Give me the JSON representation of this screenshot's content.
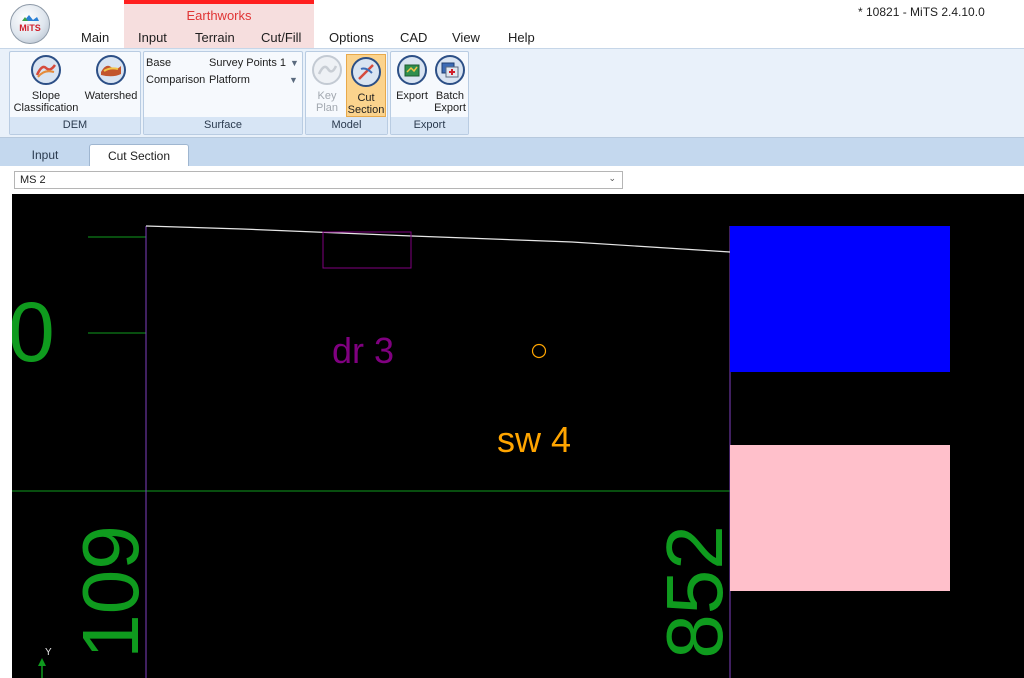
{
  "window": {
    "title": "* 10821 - MiTS 2.4.10.0"
  },
  "app_logo_text": "MiTS",
  "menu": {
    "context_group": "Earthworks",
    "tabs": [
      "Main",
      "Input",
      "Terrain",
      "Cut/Fill",
      "Options",
      "CAD",
      "View",
      "Help"
    ]
  },
  "ribbon": {
    "dem": {
      "label": "DEM",
      "slope": {
        "line1": "Slope",
        "line2": "Classification"
      },
      "watershed": {
        "line1": "Watershed"
      }
    },
    "surface": {
      "label": "Surface",
      "base_label": "Base",
      "base_value": "Survey Points 1",
      "comparison_label": "Comparison",
      "comparison_value": "Platform"
    },
    "model": {
      "label": "Model",
      "key_plan": {
        "line1": "Key",
        "line2": "Plan"
      },
      "cut_section": {
        "line1": "Cut",
        "line2": "Section"
      }
    },
    "export": {
      "label": "Export",
      "export_btn": {
        "line1": "Export"
      },
      "batch_export": {
        "line1": "Batch",
        "line2": "Export"
      }
    }
  },
  "doc_tabs": [
    "Input",
    "Cut Section"
  ],
  "section_selector": {
    "value": "MS 2"
  },
  "canvas": {
    "labels": {
      "dr": "dr 3",
      "sw": "sw 4",
      "left_partial": "0",
      "elev_left": "109",
      "elev_right": "852",
      "axis_y": "Y"
    },
    "colors": {
      "background": "#000000",
      "green": "#0f9b1e",
      "purple": "#800080",
      "orange": "#ffa500",
      "blue": "#0000ff",
      "pink": "#ffc0cb",
      "outline": "#7f3fbf"
    }
  }
}
